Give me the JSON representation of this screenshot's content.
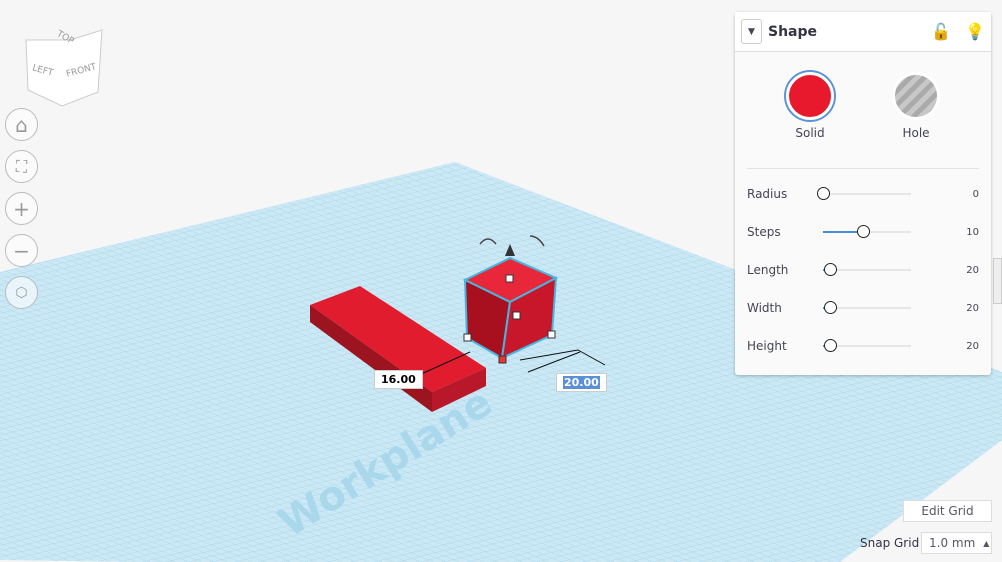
{
  "viewcube": {
    "top": "TOP",
    "left": "LEFT",
    "front": "FRONT"
  },
  "nav": [
    {
      "name": "home"
    },
    {
      "name": "fit"
    },
    {
      "name": "zoom-in"
    },
    {
      "name": "zoom-out"
    },
    {
      "name": "perspective"
    }
  ],
  "workplane_label": "Workplane",
  "dimensions": {
    "width_value": "16.00",
    "length_value": "20.00"
  },
  "panel": {
    "title": "Shape",
    "types": [
      {
        "label": "Solid",
        "color": "#e8192c"
      },
      {
        "label": "Hole",
        "color": "#aaaaaa"
      }
    ],
    "params": [
      {
        "label": "Radius",
        "value": "0",
        "fraction": 0
      },
      {
        "label": "Steps",
        "value": "10",
        "fraction": 0.45
      },
      {
        "label": "Length",
        "value": "20",
        "fraction": 0.08
      },
      {
        "label": "Width",
        "value": "20",
        "fraction": 0.08
      },
      {
        "label": "Height",
        "value": "20",
        "fraction": 0.08
      }
    ]
  },
  "edit_grid": "Edit Grid",
  "snap_grid": {
    "label": "Snap Grid",
    "value": "1.0 mm"
  }
}
